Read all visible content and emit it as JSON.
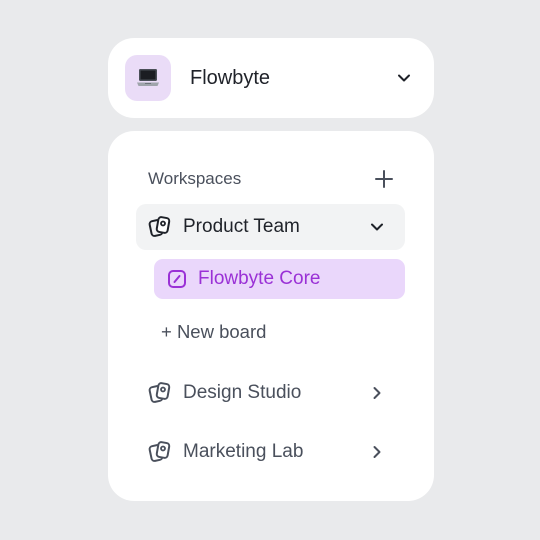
{
  "app": {
    "title": "Flowbyte",
    "icon": "laptop-icon"
  },
  "workspaces": {
    "header": "Workspaces",
    "items": [
      {
        "label": "Product Team",
        "icon": "workspace-icon",
        "expanded": true,
        "boards": [
          {
            "label": "Flowbyte Core",
            "icon": "board-icon",
            "selected": true
          }
        ],
        "new_board_label": "+ New board"
      },
      {
        "label": "Design Studio",
        "icon": "workspace-icon",
        "expanded": false
      },
      {
        "label": "Marketing Lab",
        "icon": "workspace-icon",
        "expanded": false
      }
    ]
  },
  "colors": {
    "background": "#e9eaec",
    "card": "#ffffff",
    "accent": "#9a31d6",
    "accent_bg": "#ead7fb",
    "active_row_bg": "#f2f3f4"
  }
}
